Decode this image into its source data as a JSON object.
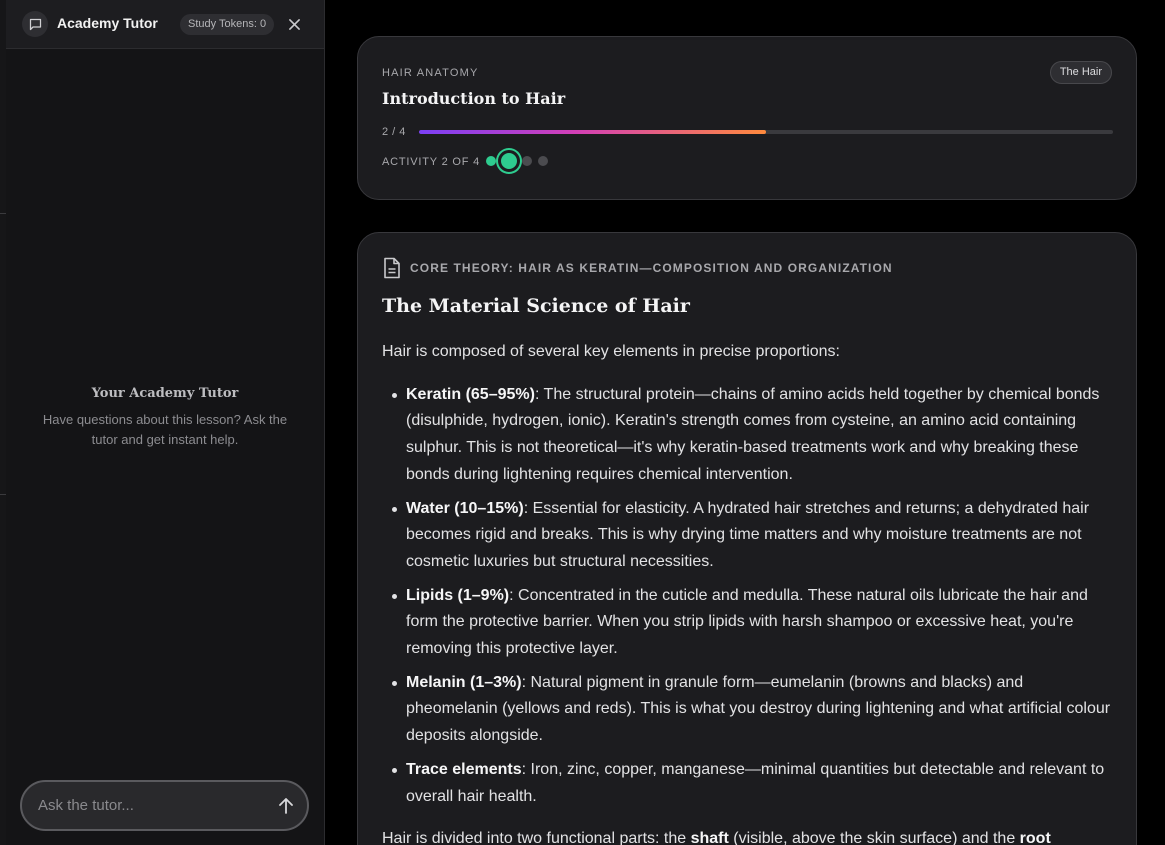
{
  "tutor": {
    "title": "Academy Tutor",
    "tokens_label": "Study Tokens: 0",
    "close_glyph": "×",
    "empty_title": "Your Academy Tutor",
    "empty_desc": "Have questions about this lesson? Ask the tutor and get instant help.",
    "input_placeholder": "Ask the tutor...",
    "input_value": ""
  },
  "lesson": {
    "kicker": "HAIR ANATOMY",
    "badge": "The Hair",
    "title": "Introduction to Hair",
    "progress_label": "2 / 4",
    "progress_fraction": 0.5,
    "activity_label": "ACTIVITY 2 OF 4",
    "activity_current": 2,
    "activity_total": 4
  },
  "theory": {
    "kicker": "CORE THEORY: HAIR AS KERATIN—COMPOSITION AND ORGANIZATION",
    "title": "The Material Science of Hair",
    "intro": "Hair is composed of several key elements in precise proportions:",
    "items": [
      {
        "term": "Keratin (65–95%)",
        "text": ": The structural protein—chains of amino acids held together by chemical bonds (disulphide, hydrogen, ionic). Keratin's strength comes from cysteine, an amino acid containing sulphur. This is not theoretical—it's why keratin-based treatments work and why breaking these bonds during lightening requires chemical intervention."
      },
      {
        "term": "Water (10–15%)",
        "text": ": Essential for elasticity. A hydrated hair stretches and returns; a dehydrated hair becomes rigid and breaks. This is why drying time matters and why moisture treatments are not cosmetic luxuries but structural necessities."
      },
      {
        "term": "Lipids (1–9%)",
        "text": ": Concentrated in the cuticle and medulla. These natural oils lubricate the hair and form the protective barrier. When you strip lipids with harsh shampoo or excessive heat, you're removing this protective layer."
      },
      {
        "term": "Melanin (1–3%)",
        "text": ": Natural pigment in granule form—eumelanin (browns and blacks) and pheomelanin (yellows and reds). This is what you destroy during lightening and what artificial colour deposits alongside."
      },
      {
        "term": "Trace elements",
        "text": ": Iron, zinc, copper, manganese—minimal quantities but detectable and relevant to overall hair health."
      }
    ],
    "outro": {
      "before": "Hair is divided into two functional parts: the ",
      "shaft": "shaft",
      "middle": " (visible, above the skin surface) and the ",
      "root": "root"
    }
  },
  "colors": {
    "accent_green": "#2ecc8f",
    "progress_start": "#7b3ff5",
    "progress_end": "#ff8a3d"
  },
  "icons": [
    "chat-bubble-icon",
    "close-icon",
    "send-arrow-icon",
    "document-icon"
  ]
}
